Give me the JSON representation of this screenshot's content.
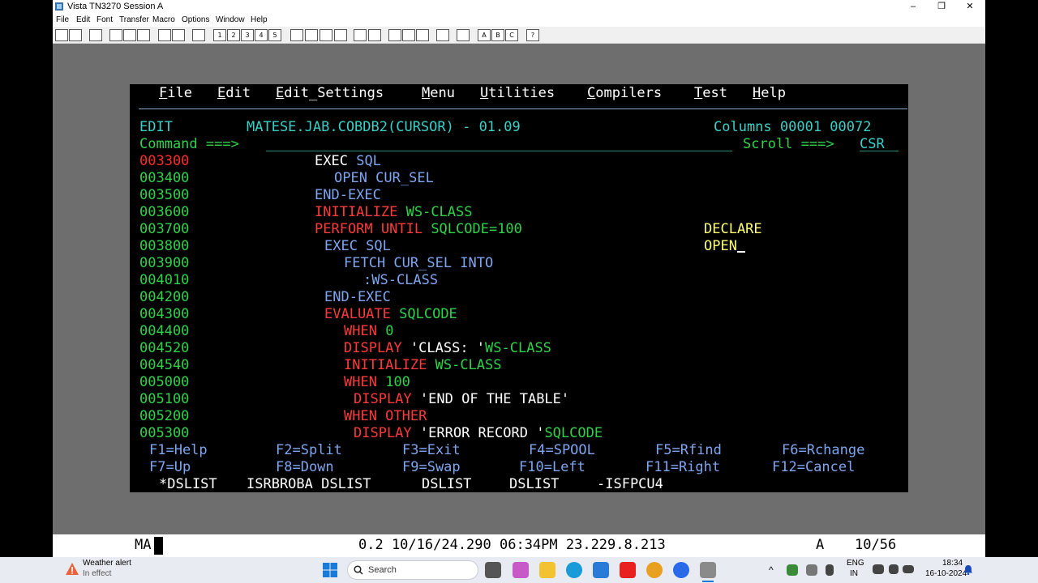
{
  "window": {
    "title": "Vista TN3270 Session A",
    "min": "–",
    "max": "❐",
    "close": "✕"
  },
  "menubar": [
    "File",
    "Edit",
    "Font",
    "Transfer",
    "Macro",
    "Options",
    "Window",
    "Help"
  ],
  "toolbar": {
    "macro_buttons": [
      "1",
      "2",
      "3",
      "4",
      "5"
    ],
    "abc_buttons": [
      "A",
      "B",
      "C"
    ],
    "help_button": "?"
  },
  "ispf": {
    "actionbar": [
      {
        "hot": "F",
        "rest": "ile"
      },
      {
        "hot": "E",
        "rest": "dit"
      },
      {
        "hot": "E",
        "rest": "dit_Settings"
      },
      {
        "hot": "M",
        "rest": "enu"
      },
      {
        "hot": "U",
        "rest": "tilities"
      },
      {
        "hot": "C",
        "rest": "ompilers"
      },
      {
        "hot": "T",
        "rest": "est"
      },
      {
        "hot": "H",
        "rest": "elp"
      }
    ],
    "mode": "EDIT",
    "dataset": "MATESE.JAB.COBDB2(CURSOR) - 01.09",
    "columns": "Columns 00001 00072",
    "command_label": "Command ===>",
    "scroll_label": "Scroll ===>",
    "scroll_value": "CSR",
    "line_numbers": [
      "003300",
      "003400",
      "003500",
      "003600",
      "003700",
      "003800",
      "003900",
      "004010",
      "004200",
      "004300",
      "004400",
      "004520",
      "004540",
      "005000",
      "005100",
      "005200",
      "005300"
    ],
    "code": {
      "l1": {
        "a": "EXEC",
        "b": "SQL"
      },
      "l2": {
        "a": "OPEN CUR_SEL"
      },
      "l3": {
        "a": "END-EXEC"
      },
      "l4": {
        "a": "INITIALIZE",
        "b": "WS-CLASS"
      },
      "l5": {
        "a": "PERFORM UNTIL",
        "b": "SQLCODE=100",
        "side": "DECLARE"
      },
      "l6": {
        "a": "EXEC SQL",
        "side": "OPEN"
      },
      "l7": {
        "a": "FETCH CUR_SEL INTO"
      },
      "l8": {
        "a": ":WS-CLASS"
      },
      "l9": {
        "a": "END-EXEC"
      },
      "l10": {
        "a": "EVALUATE",
        "b": "SQLCODE"
      },
      "l11": {
        "a": "WHEN",
        "b": "0"
      },
      "l12": {
        "a": "DISPLAY",
        "b": "'CLASS: '",
        "c": "WS-CLASS"
      },
      "l13": {
        "a": "INITIALIZE",
        "b": "WS-CLASS"
      },
      "l14": {
        "a": "WHEN",
        "b": "100"
      },
      "l15": {
        "a": "DISPLAY",
        "b": "'END OF THE TABLE'"
      },
      "l16": {
        "a": "WHEN OTHER"
      },
      "l17": {
        "a": "DISPLAY",
        "b": "'ERROR RECORD '",
        "c": "SQLCODE"
      }
    },
    "pfkeys_row1": [
      "F1=Help",
      "F2=Split",
      "F3=Exit",
      "F4=SPOOL",
      "F5=Rfind",
      "F6=Rchange"
    ],
    "pfkeys_row2": [
      "F7=Up",
      "F8=Down",
      "F9=Swap",
      "F10=Left",
      "F11=Right",
      "F12=Cancel"
    ],
    "sessions": [
      "*DSLIST",
      "ISRBROBA DSLIST",
      "DSLIST",
      "DSLIST",
      "-ISFPCU4"
    ]
  },
  "status": {
    "mode": "MA",
    "info": "0.2 10/16/24.290 06:34PM 23.229.8.213",
    "indicator": "A",
    "cursor_pos": "10/56"
  },
  "taskbar": {
    "weather_title": "Weather alert",
    "weather_sub": "In effect",
    "search_placeholder": "Search",
    "lang": "ENG",
    "region": "IN",
    "time": "18:34",
    "date": "16-10-2024"
  }
}
